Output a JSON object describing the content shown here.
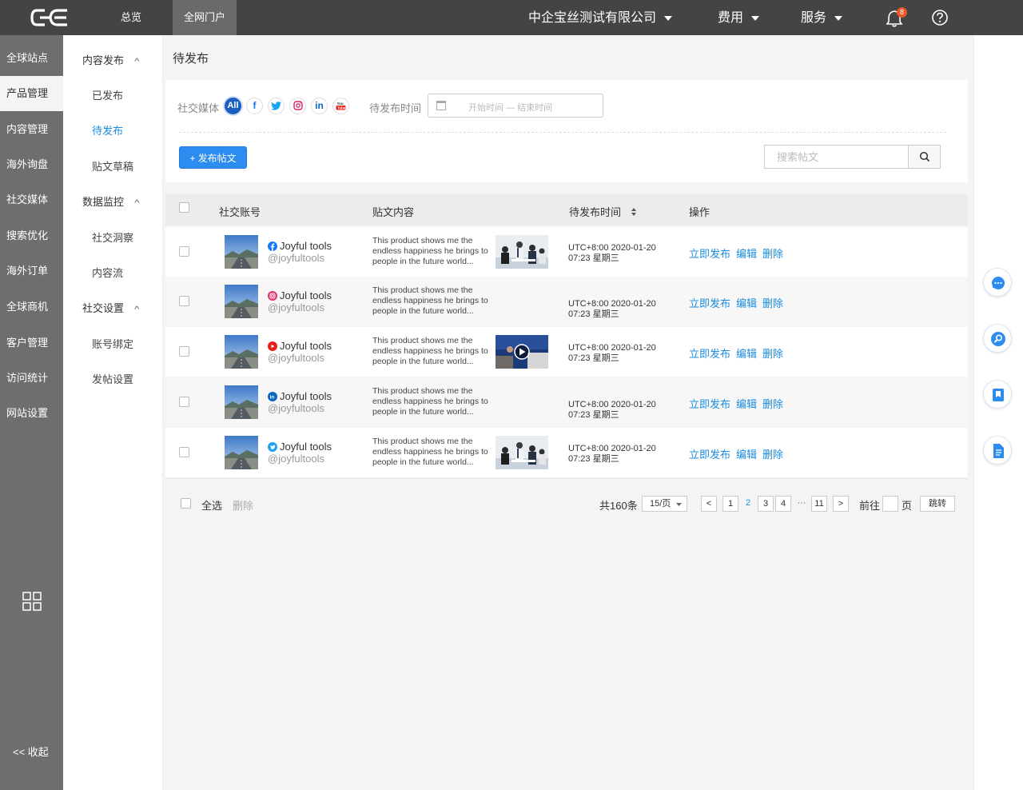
{
  "topbar": {
    "logo_text": "CE",
    "tabs": [
      {
        "label": "总览"
      },
      {
        "label": "全网门户"
      }
    ],
    "company": "中企宝丝测试有限公司",
    "menu_fees": "费用",
    "menu_service": "服务",
    "notification_count": "8"
  },
  "leftnav": {
    "items": [
      {
        "label": "全球站点"
      },
      {
        "label": "产品管理"
      },
      {
        "label": "内容管理"
      },
      {
        "label": "海外询盘"
      },
      {
        "label": "社交媒体"
      },
      {
        "label": "搜索优化"
      },
      {
        "label": "海外订单"
      },
      {
        "label": "全球商机"
      },
      {
        "label": "客户管理"
      },
      {
        "label": "访问统计"
      },
      {
        "label": "网站设置"
      }
    ],
    "active": "产品管理",
    "collapse_label": "<< 收起"
  },
  "subnav": {
    "group1": "内容发布",
    "sub1": [
      "已发布",
      "待发布",
      "贴文草稿"
    ],
    "group2": "数据监控",
    "sub2": [
      "社交洞察",
      "内容流"
    ],
    "group3": "社交设置",
    "sub3": [
      "账号绑定",
      "发帖设置"
    ],
    "active": "待发布"
  },
  "page": {
    "title": "待发布",
    "filter_social_label": "社交媒体",
    "social_all": "All",
    "filter_time_label": "待发布时间",
    "date_placeholder": "开始时间 — 结束时间",
    "publish_button": "+ 发布帖文",
    "search_placeholder": "搜索帖文"
  },
  "table": {
    "headers": {
      "account": "社交账号",
      "content": "贴文内容",
      "time": "待发布时间",
      "ops": "操作"
    },
    "rows": [
      {
        "platform": "facebook",
        "name": "Joyful tools",
        "handle": "@joyfultools",
        "text": "This product shows me the endless happiness he brings to people in the future world...",
        "image": "meeting",
        "time1": "UTC+8:00 2020-01-20",
        "time2": "07:23 星期三"
      },
      {
        "platform": "instagram",
        "name": "Joyful tools",
        "handle": "@joyfultools",
        "text": "This product shows me the endless happiness he brings to people in the future world...",
        "image": "",
        "time1": "UTC+8:00 2020-01-20",
        "time2": "07:23 星期三"
      },
      {
        "platform": "youtube",
        "name": "Joyful tools",
        "handle": "@joyfultools",
        "text": "This product shows me the endless happiness he brings to people in the future world...",
        "image": "video",
        "time1": "UTC+8:00 2020-01-20",
        "time2": "07:23 星期三"
      },
      {
        "platform": "linkedin",
        "name": "Joyful tools",
        "handle": "@joyfultools",
        "text": "This product shows me the endless happiness he brings to people in the future world...",
        "image": "",
        "time1": "UTC+8:00 2020-01-20",
        "time2": "07:23 星期三"
      },
      {
        "platform": "twitter",
        "name": "Joyful tools",
        "handle": "@joyfultools",
        "text": "This product shows me the endless happiness he brings to people in the future world...",
        "image": "meeting",
        "time1": "UTC+8:00 2020-01-20",
        "time2": "07:23 星期三"
      }
    ],
    "op_publish": "立即发布",
    "op_edit": "编辑",
    "op_delete": "删除"
  },
  "footer": {
    "select_all": "全选",
    "delete": "删除",
    "total": "共160条",
    "page_size": "15/页",
    "pages": [
      "1",
      "2",
      "3",
      "4",
      "···",
      "11"
    ],
    "current_page": "2",
    "prev": "<",
    "next": ">",
    "goto_prefix": "前往",
    "goto_suffix": "页",
    "jump": "跳转"
  },
  "colors": {
    "accent": "#1a8ce0",
    "topbar": "#444444",
    "leftnav": "#6e6e6e",
    "button": "#2d8cf0"
  }
}
